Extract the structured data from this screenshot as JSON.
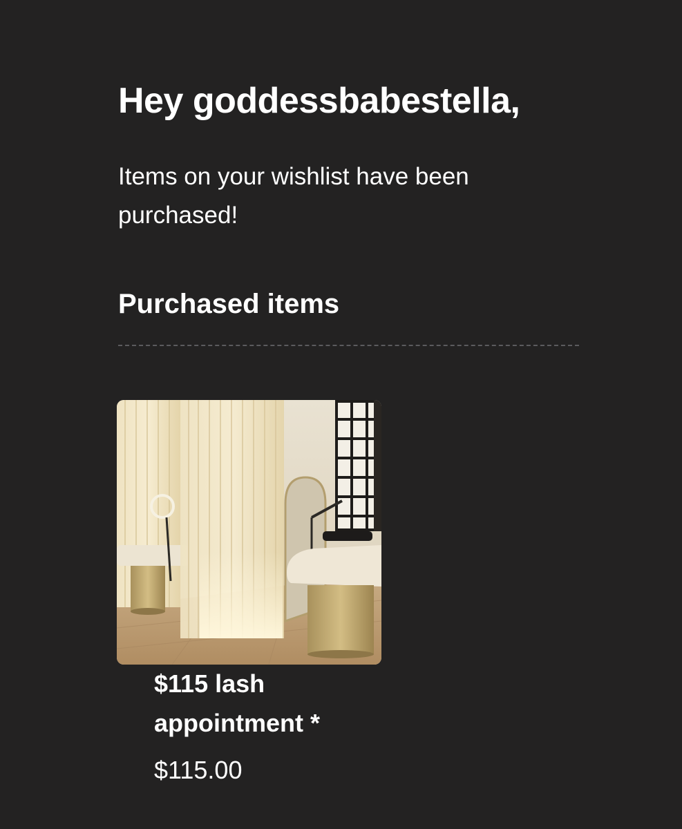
{
  "email": {
    "greeting": "Hey goddessbabestella,",
    "message": "Items on your wishlist have been purchased!",
    "section_title": "Purchased items"
  },
  "purchased_items": [
    {
      "name": "$115 lash appointment *",
      "price": "$115.00",
      "image_description": "lash-studio-photo"
    }
  ],
  "colors": {
    "background": "#232222",
    "text": "#ffffff",
    "divider": "#5b5b5e"
  }
}
